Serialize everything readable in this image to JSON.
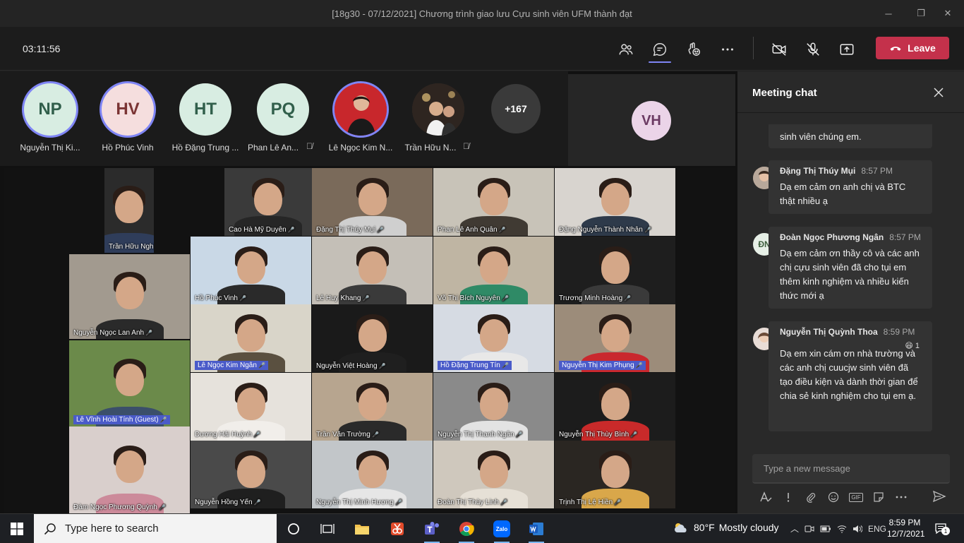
{
  "window": {
    "title": "[18g30 - 07/12/2021] Chương trình giao lưu Cựu sinh viên UFM thành đạt",
    "minimize": "─",
    "maximize": "❐",
    "close": "✕"
  },
  "toolbar": {
    "timer": "03:11:56",
    "leave_label": "Leave",
    "icons": [
      "participants-icon",
      "chat-icon",
      "reactions-icon",
      "more-icon",
      "camera-off-icon",
      "mic-off-icon",
      "share-icon"
    ]
  },
  "roster": {
    "people": [
      {
        "initials": "NP",
        "name": "Nguyễn Thị Ki...",
        "speaking": true,
        "muted": false
      },
      {
        "initials": "HV",
        "name": "Hồ Phúc Vinh",
        "speaking": true,
        "muted": false
      },
      {
        "initials": "HT",
        "name": "Hồ Đặng Trung ...",
        "speaking": false,
        "muted": false
      },
      {
        "initials": "PQ",
        "name": "Phan Lê An...",
        "speaking": false,
        "muted": true
      },
      {
        "initials": "",
        "name": "Lê Ngọc Kim N...",
        "speaking": true,
        "muted": false
      },
      {
        "initials": "",
        "name": "Trần Hữu N...",
        "speaking": false,
        "muted": true
      }
    ],
    "more_count": "+167",
    "featured_initials": "VH"
  },
  "gallery": {
    "tiles": [
      {
        "name": "Trần Hữu Nghị",
        "bg": "#2b2b2b",
        "shirt": "#2f3d5a",
        "highlight": false
      },
      {
        "name": "Cao Hà Mỹ Duyên",
        "bg": "#3a3a3a",
        "shirt": "#262626",
        "highlight": false
      },
      {
        "name": "Đặng Thị Thúy Mụi",
        "bg": "#7a6a5a",
        "shirt": "#cfcfcf",
        "highlight": false
      },
      {
        "name": "Phan Lê Anh Quân",
        "bg": "#c8c3b8",
        "shirt": "#403a33",
        "highlight": false
      },
      {
        "name": "Đặng Nguyễn Thành Nhân",
        "bg": "#d8d4cf",
        "shirt": "#2e3a4a",
        "highlight": false
      },
      {
        "name": "Nguyễn Ngọc Lan Anh",
        "bg": "#a29a8f",
        "shirt": "#2a2a2a",
        "highlight": false
      },
      {
        "name": "Hồ Phúc Vinh",
        "bg": "#c9d8e6",
        "shirt": "#2a2a2a",
        "highlight": false
      },
      {
        "name": "Lê Huy Khang",
        "bg": "#c4bfb7",
        "shirt": "#3a3a3a",
        "highlight": false
      },
      {
        "name": "Võ Thị Bích Nguyên",
        "bg": "#bfb5a3",
        "shirt": "#2f8a66",
        "highlight": false
      },
      {
        "name": "Trương Minh Hoàng",
        "bg": "#1e1e1e",
        "shirt": "#3a3a3a",
        "highlight": false
      },
      {
        "name": "Lê Ngọc Kim Ngân",
        "bg": "#d9d5c9",
        "shirt": "#5a5040",
        "highlight": true
      },
      {
        "name": "Nguyễn Việt Hoàng",
        "bg": "#1a1a1a",
        "shirt": "#1f1f1f",
        "highlight": false
      },
      {
        "name": "Hồ Đặng Trung Tín",
        "bg": "#d6dbe3",
        "shirt": "#e8e8e8",
        "highlight": true
      },
      {
        "name": "Nguyễn Thị Kim Phụng",
        "bg": "#9c8c7a",
        "shirt": "#c9282e",
        "highlight": true
      },
      {
        "name": "Lê Vĩnh Hoài Tính (Guest)",
        "bg": "#6b8a4a",
        "shirt": "#3b4f6a",
        "highlight": true
      },
      {
        "name": "Dương Hải Huỳnh",
        "bg": "#e6e2dc",
        "shirt": "#f1eeea",
        "highlight": false
      },
      {
        "name": "Trần Văn Trường",
        "bg": "#b7a58f",
        "shirt": "#2a2a2a",
        "highlight": false
      },
      {
        "name": "Nguyễn Thị Thanh Ngân",
        "bg": "#8a8a8a",
        "shirt": "#e3e3e3",
        "highlight": false
      },
      {
        "name": "Nguyễn Thị Thùy Bình",
        "bg": "#1c1c1c",
        "shirt": "#c92a2a",
        "highlight": false
      },
      {
        "name": "Đàm Ngọc Phương Quỳnh",
        "bg": "#d9cfcc",
        "shirt": "#cc8a9a",
        "highlight": false
      },
      {
        "name": "Nguyễn Hồng Yến",
        "bg": "#4a4a4a",
        "shirt": "#1f1f1f",
        "highlight": false
      },
      {
        "name": "Nguyễn Thị Minh Hương",
        "bg": "#c2c6c9",
        "shirt": "#e6e6e6",
        "highlight": false
      },
      {
        "name": "Đoàn Thị Thùy Linh",
        "bg": "#cfc8bd",
        "shirt": "#e6e0d6",
        "highlight": false
      },
      {
        "name": "Trịnh Thị Lệ Hiền",
        "bg": "#2a2622",
        "shirt": "#d9a74a",
        "highlight": false
      }
    ]
  },
  "chat": {
    "title": "Meeting chat",
    "messages": [
      {
        "author": "",
        "time": "",
        "body": "sinh viên chúng em.",
        "avatar": "none"
      },
      {
        "author": "Đặng Thị Thúy Mụi",
        "time": "8:57 PM",
        "body": "Dạ em cảm ơn anh chị và BTC thật nhiều ạ",
        "avatar": "photo"
      },
      {
        "author": "Đoàn Ngọc Phương Ngân",
        "time": "8:57 PM",
        "body": "Dạ em cảm ơn thầy cô và các anh chị cựu sinh viên đã cho tụi em thêm kinh nghiệm và nhiều kiến thức mới ạ",
        "avatar": "ĐN"
      },
      {
        "author": "Nguyễn Thị Quỳnh Thoa",
        "time": "8:59 PM",
        "body": "Dạ em xin cám ơn nhà trường và các anh chị cuucjw sinh viên đã tạo điều kiện và dành thời gian để chia sẻ kinh nghiệm cho tụi em ạ.",
        "avatar": "photo",
        "reaction": "😄",
        "reaction_count": "1"
      }
    ],
    "composer_placeholder": "Type a new message",
    "tools": [
      "format-icon",
      "urgent-icon",
      "attach-icon",
      "emoji-icon",
      "gif-icon",
      "sticker-icon",
      "more-icon"
    ],
    "gif_label": "GIF"
  },
  "taskbar": {
    "search_placeholder": "Type here to search",
    "weather_temp": "80°F",
    "weather_text": "Mostly cloudy",
    "lang": "ENG",
    "time": "8:59 PM",
    "date": "12/7/2021",
    "notif_count": "1",
    "zalo_label": "Zalo"
  },
  "colors": {
    "accent": "#7f85f5",
    "leave": "#c4314b",
    "highlight_caption": "#4a5bc9"
  }
}
